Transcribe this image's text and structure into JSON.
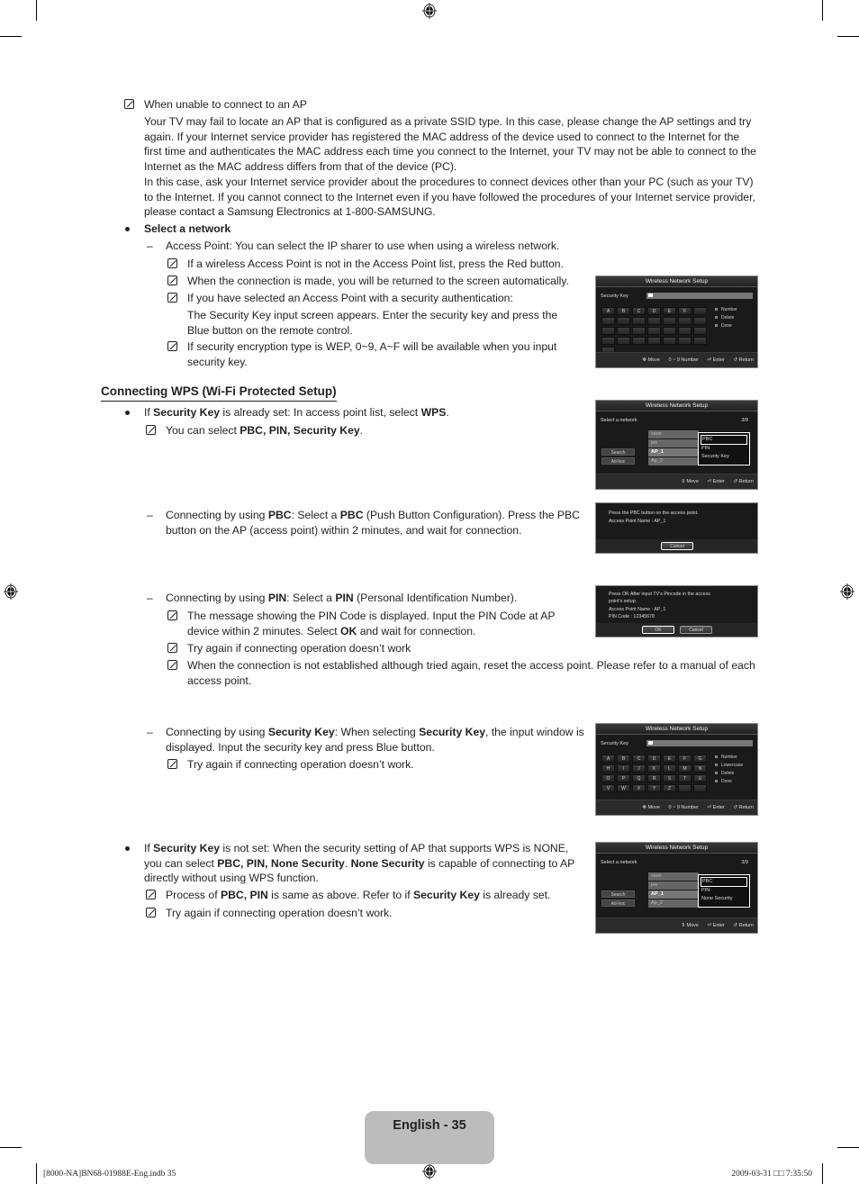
{
  "page": {
    "number_label": "English - 35"
  },
  "slug": {
    "left": "[8000-NA]BN68-01988E-Eng.indb   35",
    "right": "2009-03-31   □□ 7:35:50"
  },
  "icons": {
    "note": "note-pencil-icon",
    "registration": "registration-mark-icon",
    "bullet": "bullet-icon"
  },
  "section1": {
    "note_title": "When unable to connect to an AP",
    "para1": [
      "Your TV may fail to locate an AP that is configured as a private SSID type. In this case, please change the AP settings and try",
      "again. If your Internet service provider has registered the MAC address of the device used to connect to the Internet for the",
      "first time and authenticates the MAC address each time you connect to the Internet, your TV may not be able to connect to the",
      "Internet as the MAC address differs from that of the device (PC)."
    ],
    "para2": [
      "In this case, ask your Internet service provider about the procedures to connect devices other than your PC (such as your TV)",
      "to the Internet. If you cannot connect to the Internet even if you have followed the procedures of your Internet service provider,",
      "please contact a Samsung Electronics at 1-800-SAMSUNG."
    ]
  },
  "select_network": {
    "bullet": "Select a network",
    "dash": "Access Point: You can select the IP sharer to use when using a wireless network.",
    "notes": [
      "If a wireless Access Point is not in the Access Point list, press the Red button.",
      "When the connection is made, you will be returned to the screen automatically.",
      "If you have selected an Access Point with a security authentication:"
    ],
    "security_text": [
      "The Security Key input screen appears. Enter the security key and press the",
      "Blue button on the remote control."
    ],
    "wep_note": [
      "If security encryption type is WEP, 0~9, A~F will be available when you input",
      "security key."
    ]
  },
  "wps": {
    "heading": "Connecting WPS (Wi-Fi Protected Setup)",
    "bullet1": {
      "pre": "If ",
      "b1": "Security Key",
      "mid": " is already set: In access point list, select ",
      "b2": "WPS",
      "post": "."
    },
    "note1": {
      "pre": "You can select ",
      "b": "PBC, PIN, Security Key",
      "post": "."
    },
    "pbc": {
      "l1_pre": "Connecting by using ",
      "l1_b1": "PBC",
      "l1_mid": ": Select a ",
      "l1_b2": "PBC",
      "l1_post": " (Push Button Configuration). Press the PBC",
      "l2": "button on the AP (access point) within 2 minutes, and wait for connection."
    },
    "pin": {
      "l1_pre": "Connecting by using ",
      "l1_b1": "PIN",
      "l1_mid": ": Select a ",
      "l1_b2": "PIN",
      "l1_post": " (Personal Identification Number).",
      "note1_l1": "The message showing the PIN Code is displayed. Input the PIN Code at AP",
      "note1_l2_pre": "device within 2 minutes. Select ",
      "note1_l2_b": "OK",
      "note1_l2_post": " and wait for connection.",
      "note2": "Try again if connecting operation doesn’t work",
      "note3_l1": "When the connection is not established although tried again, reset the access point. Please refer to a manual of each",
      "note3_l2": "access point."
    },
    "seckey": {
      "l1_pre": "Connecting by using ",
      "l1_b1": "Security Key",
      "l1_mid": ": When selecting ",
      "l1_b2": "Security Key",
      "l1_post": ", the input window is",
      "l2": "displayed. Input the security key and press Blue button.",
      "note": "Try again if connecting operation doesn’t work."
    },
    "bullet2": {
      "l1_pre": "If ",
      "l1_b": "Security Key",
      "l1_post": " is not set: When the security setting of AP that supports WPS is NONE,",
      "l2_pre": "you can select ",
      "l2_b1": "PBC, PIN, None Security",
      "l2_mid": ". ",
      "l2_b2": "None Security",
      "l2_post": " is capable of connecting to AP",
      "l3": "directly without using WPS function.",
      "note1_pre": "Process of ",
      "note1_b1": "PBC, PIN",
      "note1_mid": " is same as above. Refer to if ",
      "note1_b2": "Security Key",
      "note1_post": " is already set.",
      "note2": "Try again if connecting operation doesn’t work."
    }
  },
  "screens": {
    "title": "Wireless Network Setup",
    "security_key_label": "Security Key",
    "key_cursor": "_",
    "hex_keys": [
      "A",
      "B",
      "C",
      "D",
      "E",
      "F",
      "",
      "",
      "",
      "",
      "",
      "",
      "",
      "",
      "",
      "",
      "",
      "",
      "",
      "",
      "",
      "",
      "",
      "",
      "",
      "",
      "",
      "",
      ""
    ],
    "alpha_keys": [
      "A",
      "B",
      "C",
      "D",
      "E",
      "F",
      "G",
      "H",
      "I",
      "J",
      "K",
      "L",
      "M",
      "N",
      "O",
      "P",
      "Q",
      "R",
      "S",
      "T",
      "U",
      "V",
      "W",
      "X",
      "Y",
      "Z",
      "",
      ""
    ],
    "legend_hex": [
      "Number",
      "Delete",
      "Done"
    ],
    "legend_alpha": [
      "Number",
      "Lowercase",
      "Delete",
      "Done"
    ],
    "foot_keypad": {
      "move": "Move",
      "number": "0 ~ 9 Number",
      "enter": "Enter",
      "return": "Return"
    },
    "foot_list": {
      "move": "Move",
      "enter": "Enter",
      "return": "Return"
    },
    "select_network_label": "Select a network",
    "page_count": "3/9",
    "ap_list": [
      "sson",
      "jee",
      "AP_1",
      "Ap_2"
    ],
    "selected_ap": "AP_1",
    "side_buttons": [
      "Search",
      "Ad-hoc"
    ],
    "popup1": [
      "PBC",
      "PIN",
      "Security Key"
    ],
    "popup2": [
      "PBC",
      "PIN",
      "None Security"
    ],
    "pbc_msg": [
      "Press the PBC button on the access point.",
      "Access Point Name : AP_1"
    ],
    "pin_msg": [
      "Press OK After input TV’s Pincode in the access",
      "point’s setup.",
      "Access Point Name : AP_1",
      "PIN Code : 12345678"
    ],
    "ok_label": "OK",
    "cancel_label": "Cancel"
  }
}
